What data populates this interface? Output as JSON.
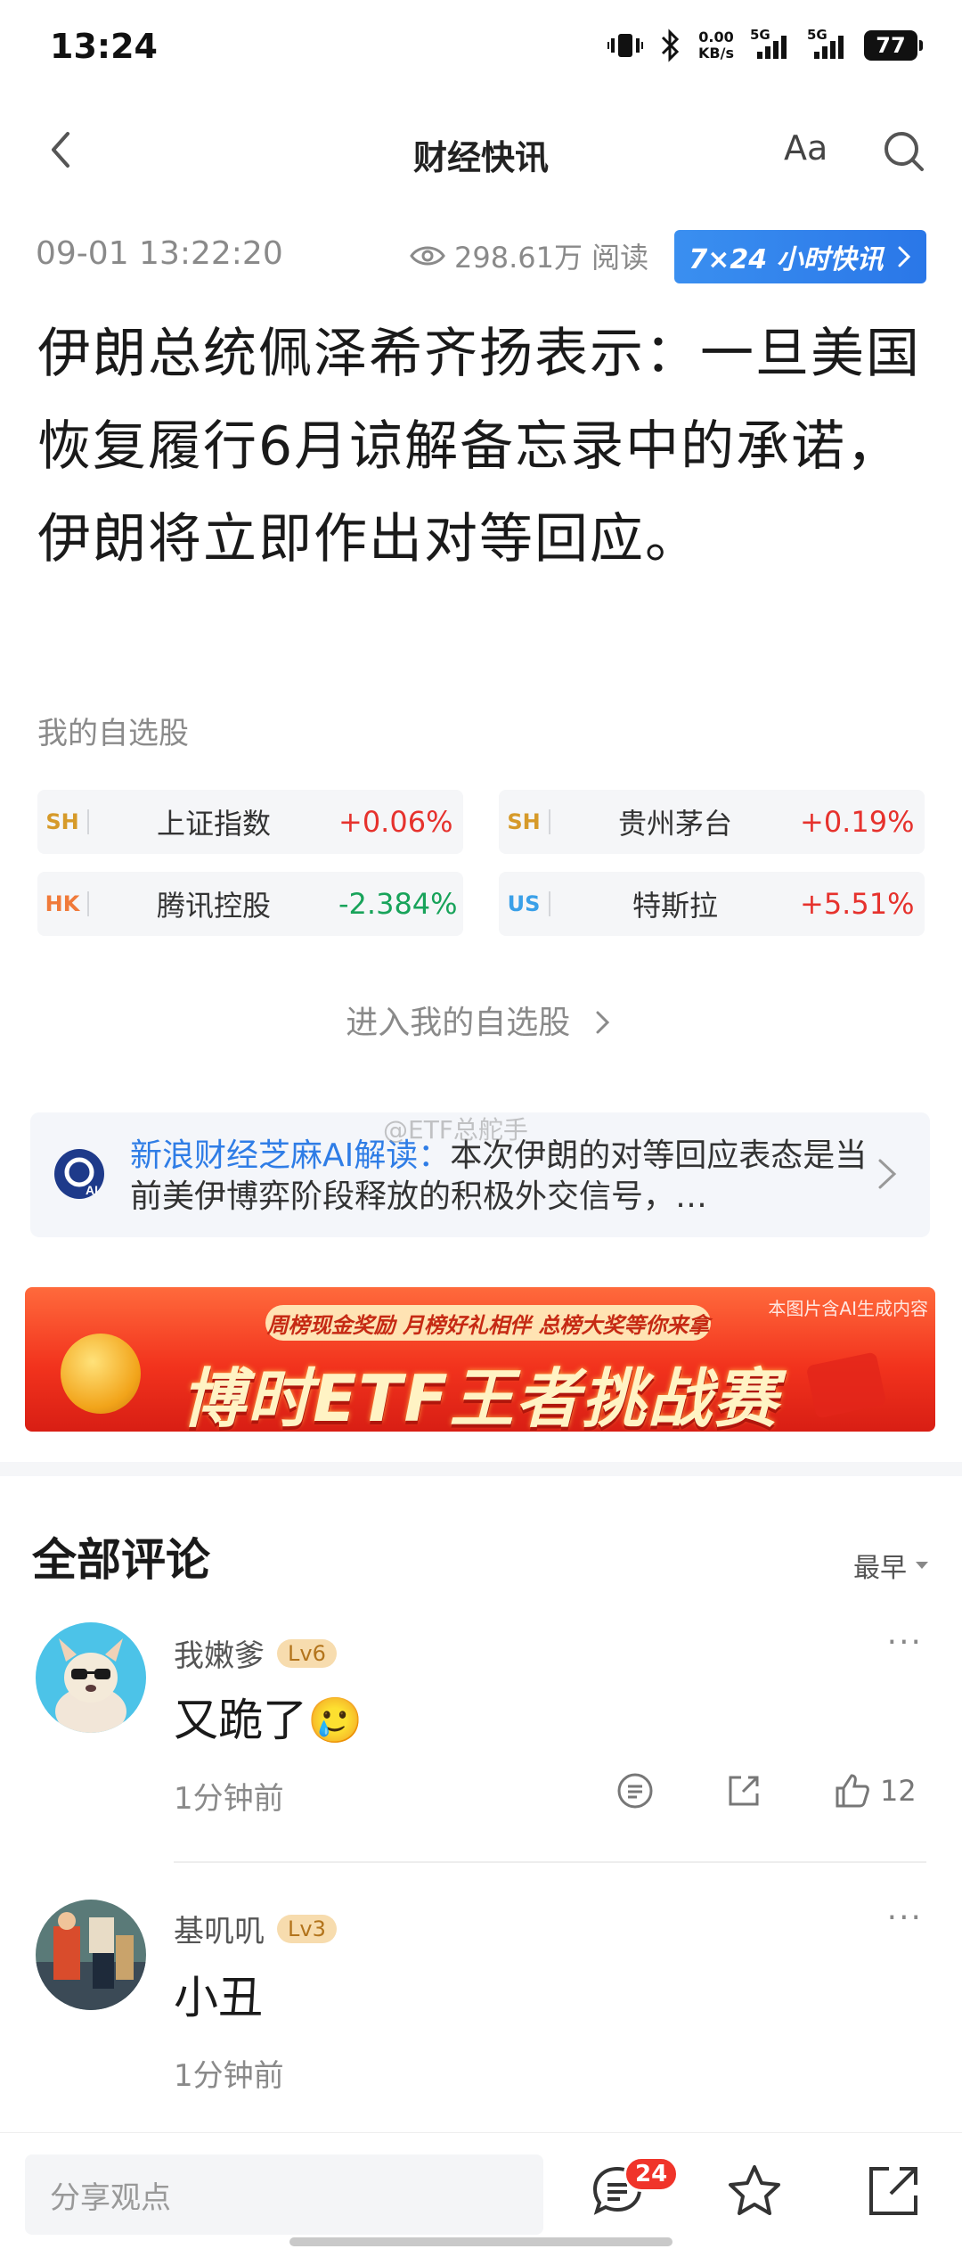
{
  "status_bar": {
    "time": "13:24",
    "speed_value": "0.00",
    "speed_unit": "KB/s",
    "net1": "5G",
    "net2": "5G",
    "battery": "77"
  },
  "header": {
    "title": "财经快讯",
    "font_label": "Aa"
  },
  "meta": {
    "date": "09-01 13:22:20",
    "reads": "298.61万 阅读",
    "badge": "7×24 小时快讯"
  },
  "headline": "伊朗总统佩泽希齐扬表示：一旦美国恢复履行6月谅解备忘录中的承诺，伊朗将立即作出对等回应。",
  "watchlist": {
    "title": "我的自选股",
    "stocks": [
      {
        "market": "SH",
        "name": "上证指数",
        "change": "+0.06%"
      },
      {
        "market": "SH",
        "name": "贵州茅台",
        "change": "+0.19%"
      },
      {
        "market": "HK",
        "name": "腾讯控股",
        "change": "-2.384%"
      },
      {
        "market": "US",
        "name": "特斯拉",
        "change": "+5.51%"
      }
    ],
    "enter_label": "进入我的自选股"
  },
  "ai_card": {
    "label": "新浪财经芝麻AI解读：",
    "text": "本次伊朗的对等回应表态是当前美伊博弈阶段释放的积极外交信号，…",
    "logo_text": "AI"
  },
  "watermark": "@ETF总舵手",
  "banner": {
    "subtitle": "周榜现金奖励 月榜好礼相伴 总榜大奖等你来拿",
    "main": "博时ETF王者挑战赛",
    "note": "本图片含AI生成内容"
  },
  "comments": {
    "title": "全部评论",
    "sort": "最早",
    "items": [
      {
        "user": "我嫩爹",
        "level": "Lv6",
        "text": "又跪了🥲",
        "time": "1分钟前",
        "likes": "12"
      },
      {
        "user": "基叽叽",
        "level": "Lv3",
        "text": "小丑",
        "time": "1分钟前"
      }
    ]
  },
  "bottom_bar": {
    "placeholder": "分享观点",
    "comment_count": "24"
  },
  "colors": {
    "up": "#e6322d",
    "down": "#18a35a",
    "accent": "#2f7de6",
    "sh": "#d69a2a",
    "hk": "#f07a3a",
    "us": "#3aa0e8"
  }
}
